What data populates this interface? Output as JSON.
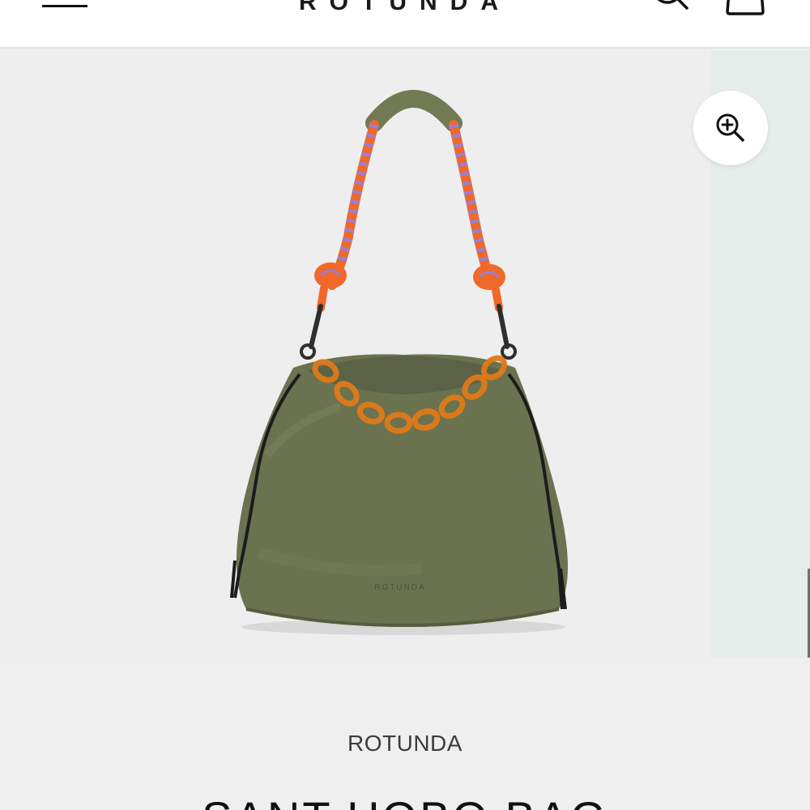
{
  "header": {
    "logo_text": "ROTUNDA",
    "menu_icon": "hamburger-menu-icon",
    "search_icon": "search-icon",
    "cart_icon": "shopping-bag-icon"
  },
  "gallery": {
    "zoom_icon": "zoom-in-icon",
    "product_image": "olive green padded hobo bag with orange rope handle and tortoiseshell chain",
    "bag_logo_text": "ROTUNDA"
  },
  "product": {
    "brand": "ROTUNDA",
    "name": "SANT HOBO BAG"
  },
  "colors": {
    "bag_olive": "#6b7250",
    "rope_orange": "#f0682a",
    "chain_amber": "#e07a18",
    "panel_bg": "#eeeeee",
    "next_slide_bg": "#e6ecea"
  }
}
